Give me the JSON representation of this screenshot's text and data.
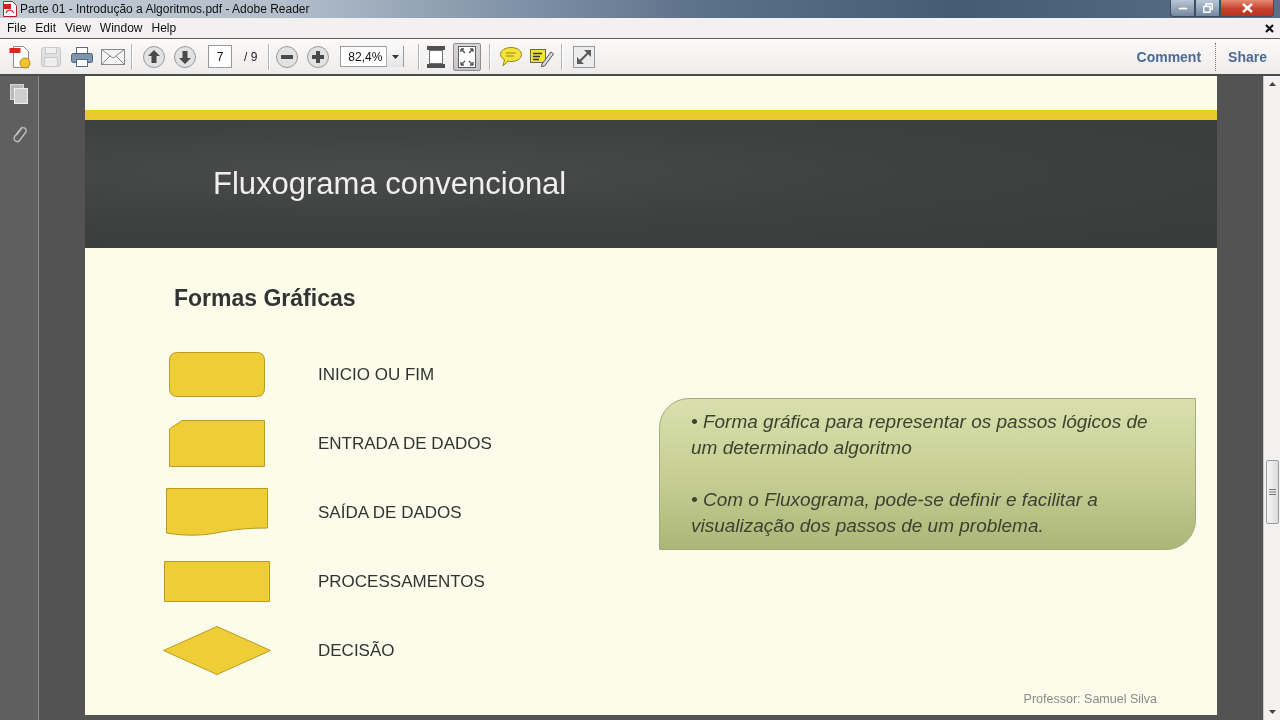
{
  "window": {
    "title": "Parte 01 - Introdução a Algoritmos.pdf - Adobe Reader"
  },
  "menu": [
    "File",
    "Edit",
    "View",
    "Window",
    "Help"
  ],
  "toolbar": {
    "file_tools": [
      {
        "kind": "create",
        "disabled": false
      },
      {
        "kind": "save",
        "disabled": true
      },
      {
        "kind": "print",
        "disabled": false
      },
      {
        "kind": "email",
        "disabled": false
      }
    ],
    "page_field": {
      "value": "7"
    },
    "page_total": "/ 9",
    "zoom_field": {
      "value": "82,4%"
    },
    "view_tools": [
      {
        "kind": "fit-width",
        "selected": false
      },
      {
        "kind": "fit-page",
        "selected": true
      }
    ],
    "links": [
      "Comment",
      "Share"
    ]
  },
  "slide": {
    "title": "Fluxograma convencional",
    "heading": "Formas Gráficas",
    "shapes": [
      {
        "kind": "terminal",
        "label": "INICIO OU FIM"
      },
      {
        "kind": "manual-input",
        "label": "ENTRADA DE DADOS"
      },
      {
        "kind": "document",
        "label": "SAÍDA DE DADOS"
      },
      {
        "kind": "process",
        "label": "PROCESSAMENTOS"
      },
      {
        "kind": "decision",
        "label": "DECISÃO"
      }
    ],
    "callout": {
      "bullets": [
        "• Forma gráfica para representar os passos lógicos de um determinado algoritmo",
        "• Com o Fluxograma, pode-se definir e facilitar a visualização dos passos de um problema."
      ]
    },
    "footer": "Professor: Samuel Silva"
  }
}
